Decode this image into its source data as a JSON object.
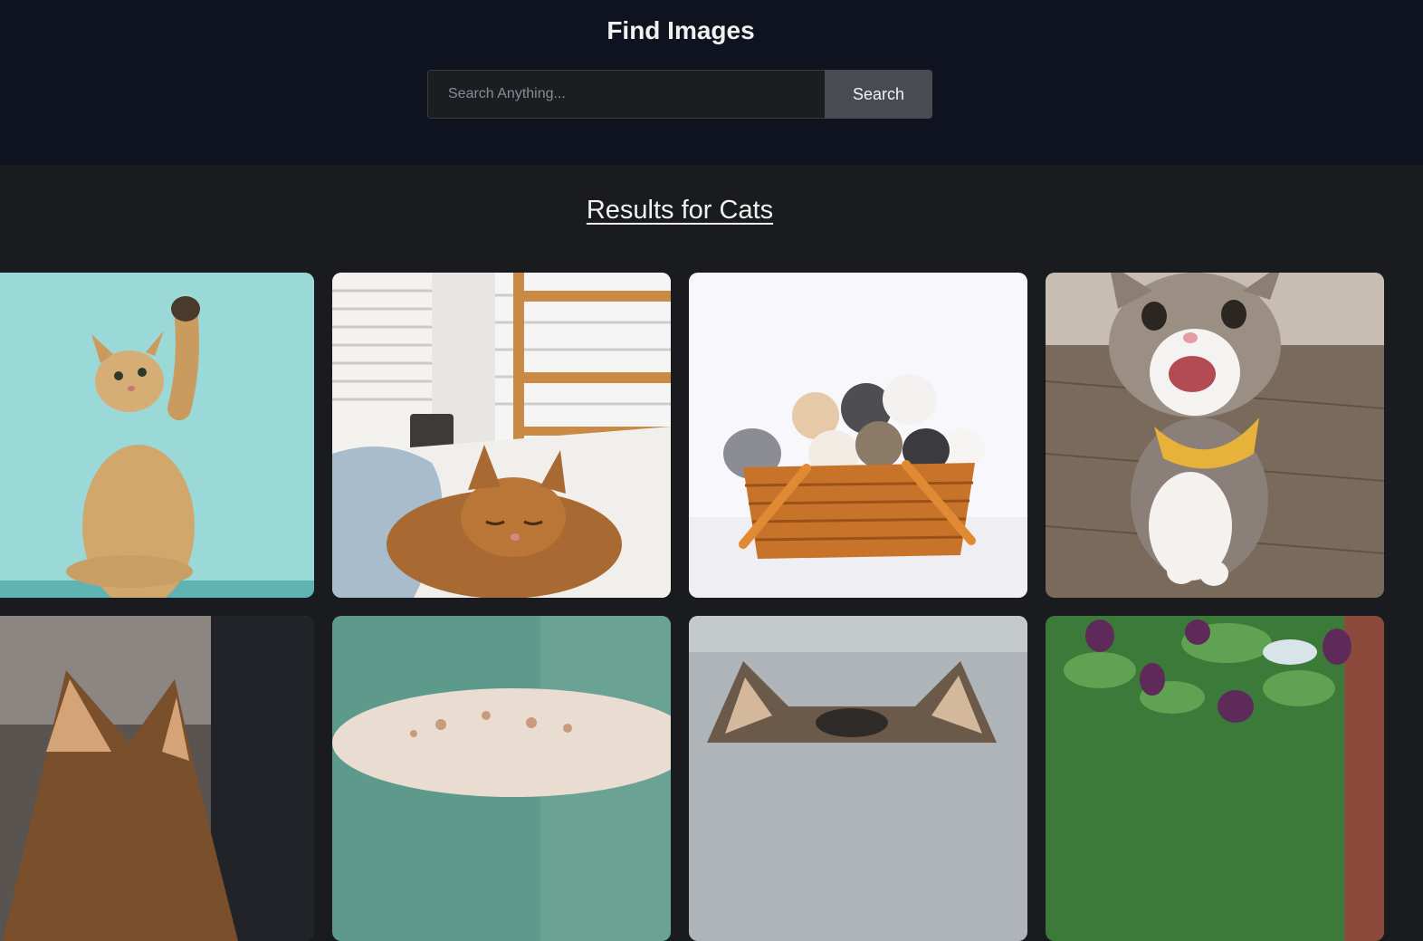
{
  "header": {
    "title": "Find Images"
  },
  "search": {
    "placeholder": "Search Anything...",
    "value": "",
    "button_label": "Search"
  },
  "results": {
    "heading": "Results for Cats"
  },
  "colors": {
    "header_bg": "#0f1320",
    "page_bg": "#1a1b1e",
    "button_bg": "#484b52",
    "text": "#f1f1f1"
  }
}
